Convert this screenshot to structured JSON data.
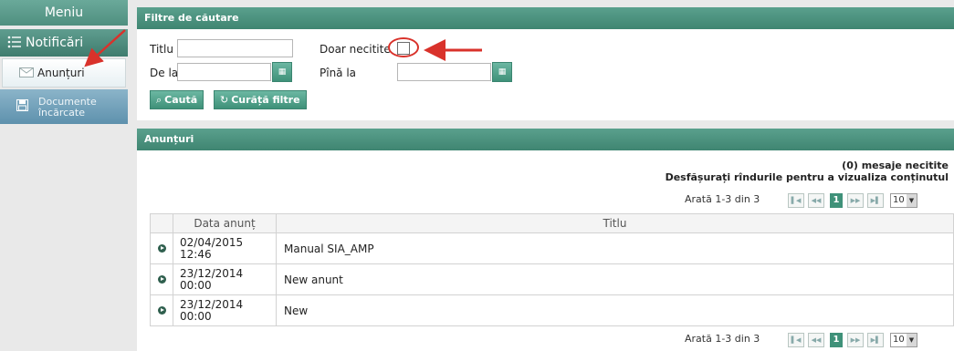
{
  "sidebar": {
    "title": "Meniu",
    "notif_label": "Notificări",
    "items": [
      {
        "label": "Anunțuri",
        "icon": "envelope-icon"
      },
      {
        "label_line1": "Documente",
        "label_line2": "încărcate",
        "icon": "document-icon"
      }
    ]
  },
  "filters": {
    "header": "Filtre de căutare",
    "titlu_label": "Titlu",
    "titlu_value": "",
    "dela_label": "De la",
    "dela_value": "",
    "pina_label": "Pînă la",
    "pina_value": "",
    "doar_label": "Doar necitite",
    "doar_checked": false,
    "search_label": "Caută",
    "clear_label": "Curăță filtre"
  },
  "announcements": {
    "header": "Anunțuri",
    "unread": "(0) mesaje necitite",
    "hint": "Desfășurați rîndurile pentru a vizualiza conținutul",
    "pager_text": "Arată 1-3 din 3",
    "current_page": "1",
    "page_size": "10",
    "columns": [
      "Data anunț",
      "Titlu"
    ],
    "rows": [
      {
        "date1": "02/04/2015",
        "date2": "12:46",
        "title": "Manual SIA_AMP"
      },
      {
        "date1": "23/12/2014",
        "date2": "00:00",
        "title": "New anunt"
      },
      {
        "date1": "23/12/2014",
        "date2": "00:00",
        "title": "New"
      }
    ]
  },
  "colors": {
    "accent": "#3f9179",
    "annotation": "#d9322b"
  }
}
